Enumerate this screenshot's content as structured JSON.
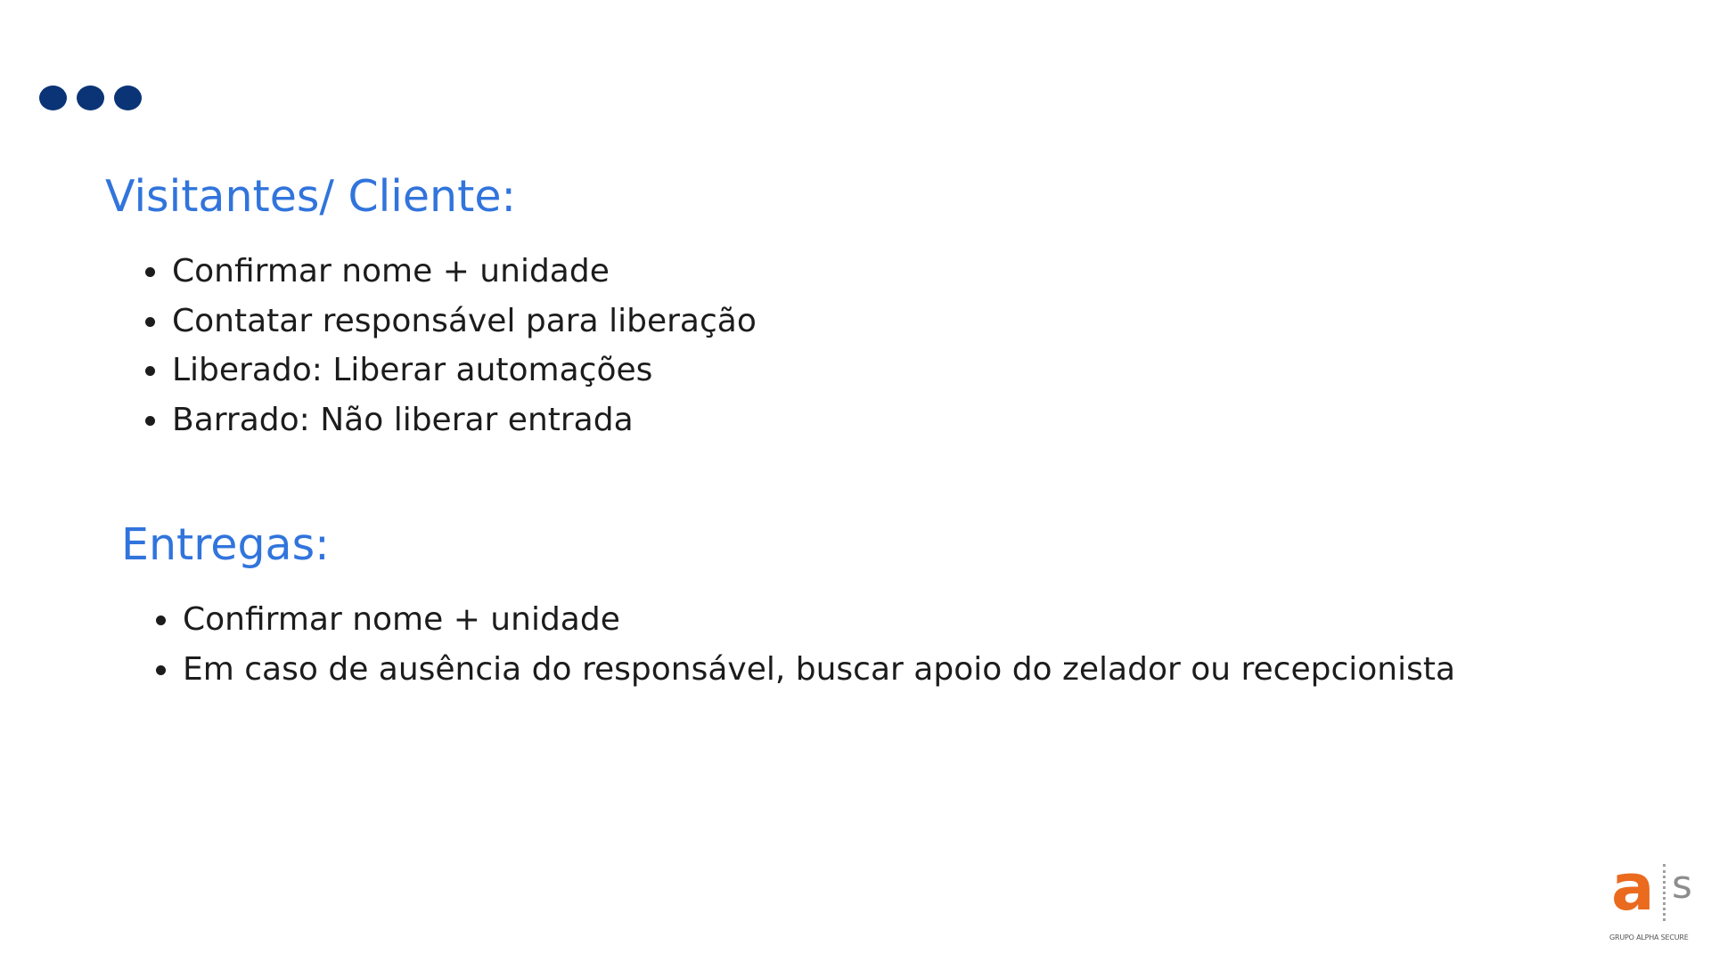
{
  "decoration": {
    "dots_icon": "three-dots-icon",
    "dot_color": "#0b3477"
  },
  "colors": {
    "heading": "#3174dc",
    "body_text": "#1c1c1c",
    "logo_accent": "#ea6a1e",
    "logo_gray": "#8d8d8d"
  },
  "sections": [
    {
      "title": "Visitantes/ Cliente:",
      "items": [
        "Confirmar nome + unidade",
        "Contatar responsável para liberação",
        "Liberado: Liberar automações",
        "Barrado: Não liberar entrada"
      ]
    },
    {
      "title": "Entregas:",
      "items": [
        "Confirmar nome + unidade",
        "Em caso de ausência do responsável, buscar apoio do zelador ou recepcionista"
      ]
    }
  ],
  "logo": {
    "letter_a": "a",
    "letter_s": "s",
    "caption": "GRUPO ALPHA SECURE"
  }
}
